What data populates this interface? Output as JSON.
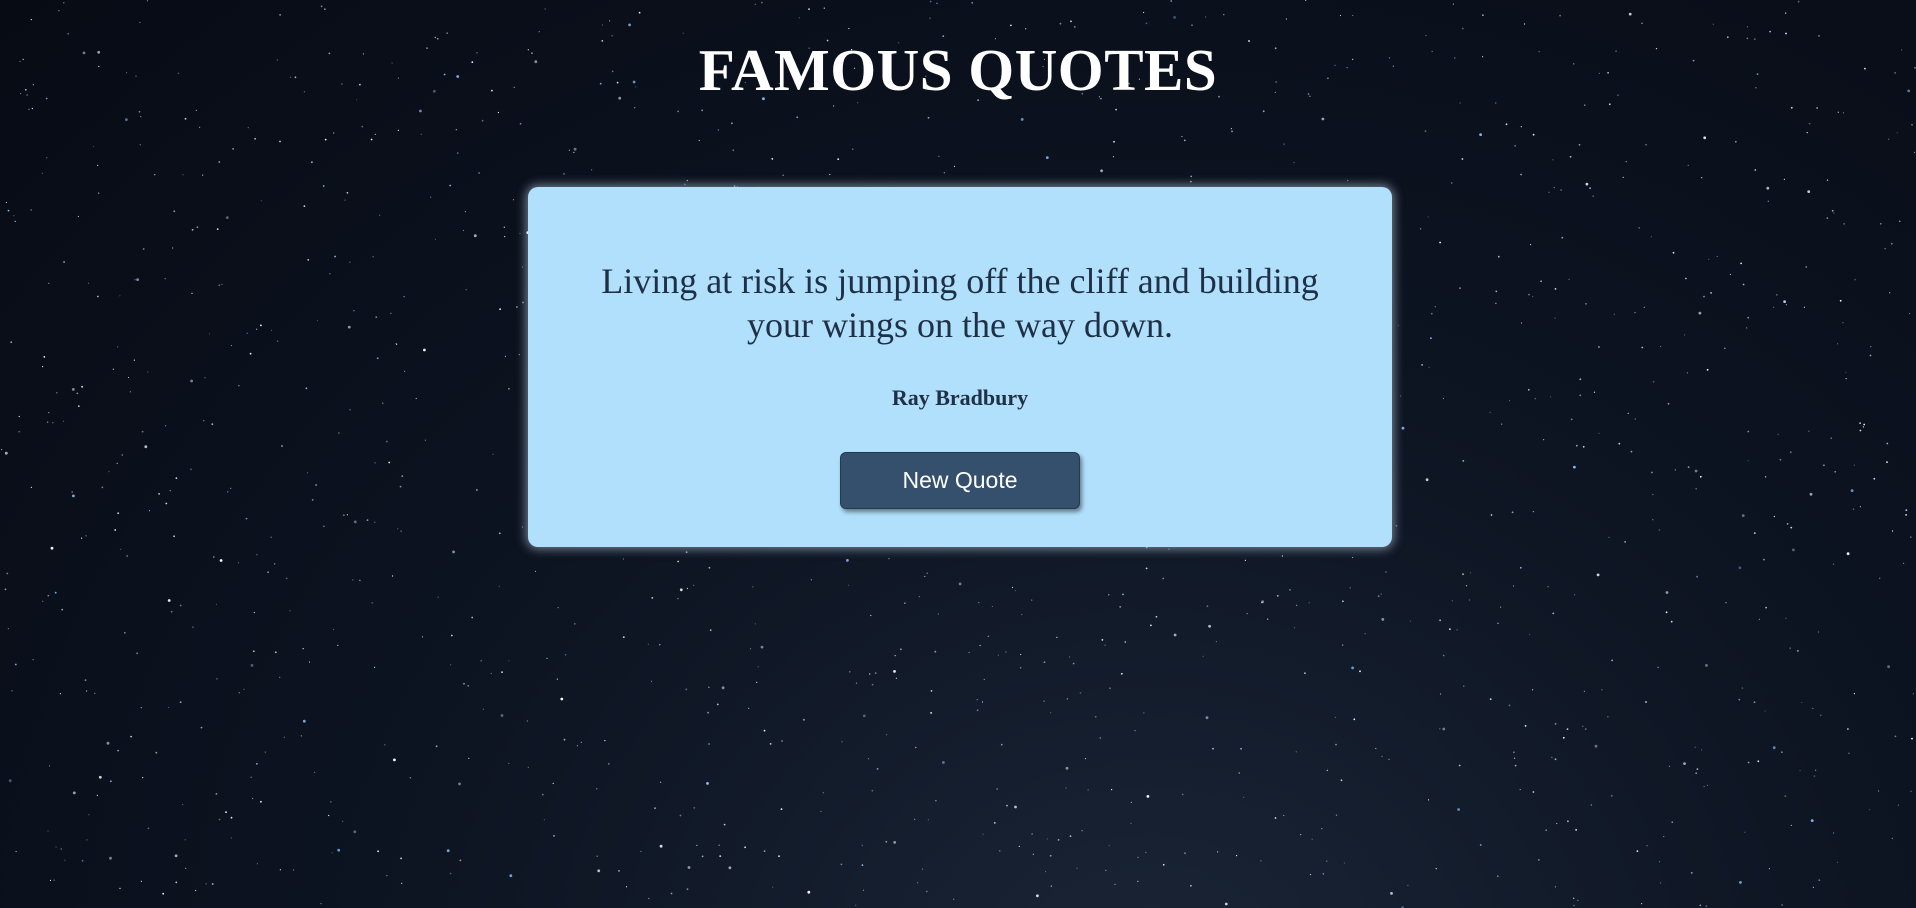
{
  "header": {
    "title": "FAMOUS QUOTES"
  },
  "quote": {
    "text": "Living at risk is jumping off the cliff and building your wings on the way down.",
    "author": "Ray Bradbury"
  },
  "actions": {
    "new_quote_label": "New Quote"
  },
  "colors": {
    "background": "#090e1a",
    "card": "#b0e0fb",
    "text": "#1f3046",
    "button": "#35506c",
    "button_text": "#ffffff",
    "title": "#ffffff"
  }
}
